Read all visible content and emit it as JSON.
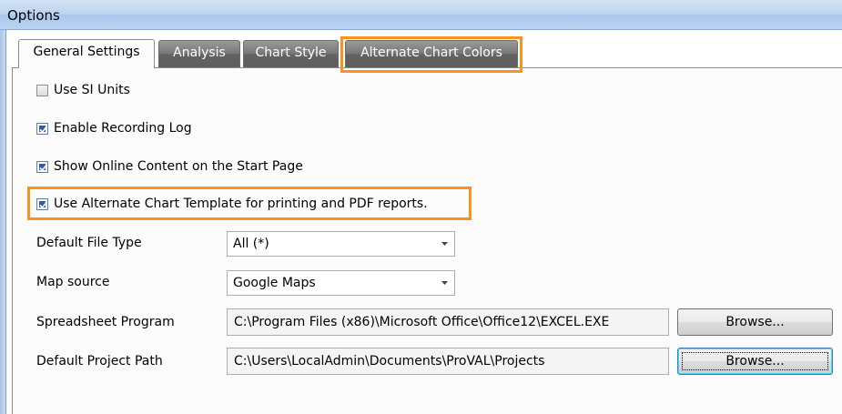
{
  "window": {
    "title": "Options"
  },
  "tabs": [
    {
      "label": "General Settings",
      "active": true
    },
    {
      "label": "Analysis",
      "active": false
    },
    {
      "label": "Chart Style",
      "active": false
    },
    {
      "label": "Alternate Chart Colors",
      "active": false,
      "highlighted": true
    }
  ],
  "checkboxes": [
    {
      "label": "Use SI Units",
      "checked": false
    },
    {
      "label": "Enable Recording Log",
      "checked": true
    },
    {
      "label": "Show Online Content on the Start Page",
      "checked": true
    },
    {
      "label": "Use Alternate Chart Template for printing and PDF reports.",
      "checked": true,
      "highlighted": true
    }
  ],
  "default_file_type": {
    "label": "Default File Type",
    "value": "All (*)"
  },
  "map_source": {
    "label": "Map source",
    "value": "Google Maps"
  },
  "spreadsheet_program": {
    "label": "Spreadsheet Program",
    "value": "C:\\Program Files (x86)\\Microsoft Office\\Office12\\EXCEL.EXE",
    "button": "Browse..."
  },
  "default_project_path": {
    "label": "Default Project Path",
    "value": "C:\\Users\\LocalAdmin\\Documents\\ProVAL\\Projects",
    "button": "Browse..."
  },
  "colors": {
    "highlight": "#f7941d",
    "checkmark": "#2d58b4",
    "tab_inactive": "#6e6e6e"
  },
  "icons": {
    "checkbox_mark": "checkmark-icon",
    "dropdown": "chevron-down-icon"
  }
}
